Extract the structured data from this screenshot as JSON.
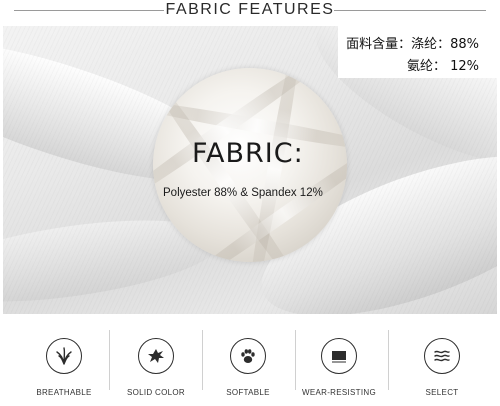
{
  "header": {
    "title": "FABRIC FEATURES"
  },
  "composition": {
    "line1": "面料含量：涤纶：88%",
    "line2": "氨纶：  12%"
  },
  "fabric": {
    "title": "FABRIC:",
    "subtitle": "Polyester 88% & Spandex 12%"
  },
  "features": [
    {
      "label": "BREATHABLE",
      "icon": "grass-icon"
    },
    {
      "label": "SOLID COLOR",
      "icon": "splash-icon"
    },
    {
      "label": "SOFTABLE",
      "icon": "paw-icon"
    },
    {
      "label": "WEAR-RESISTING",
      "icon": "fabric-swatch-icon"
    },
    {
      "label": "SELECT",
      "icon": "thread-icon"
    }
  ]
}
